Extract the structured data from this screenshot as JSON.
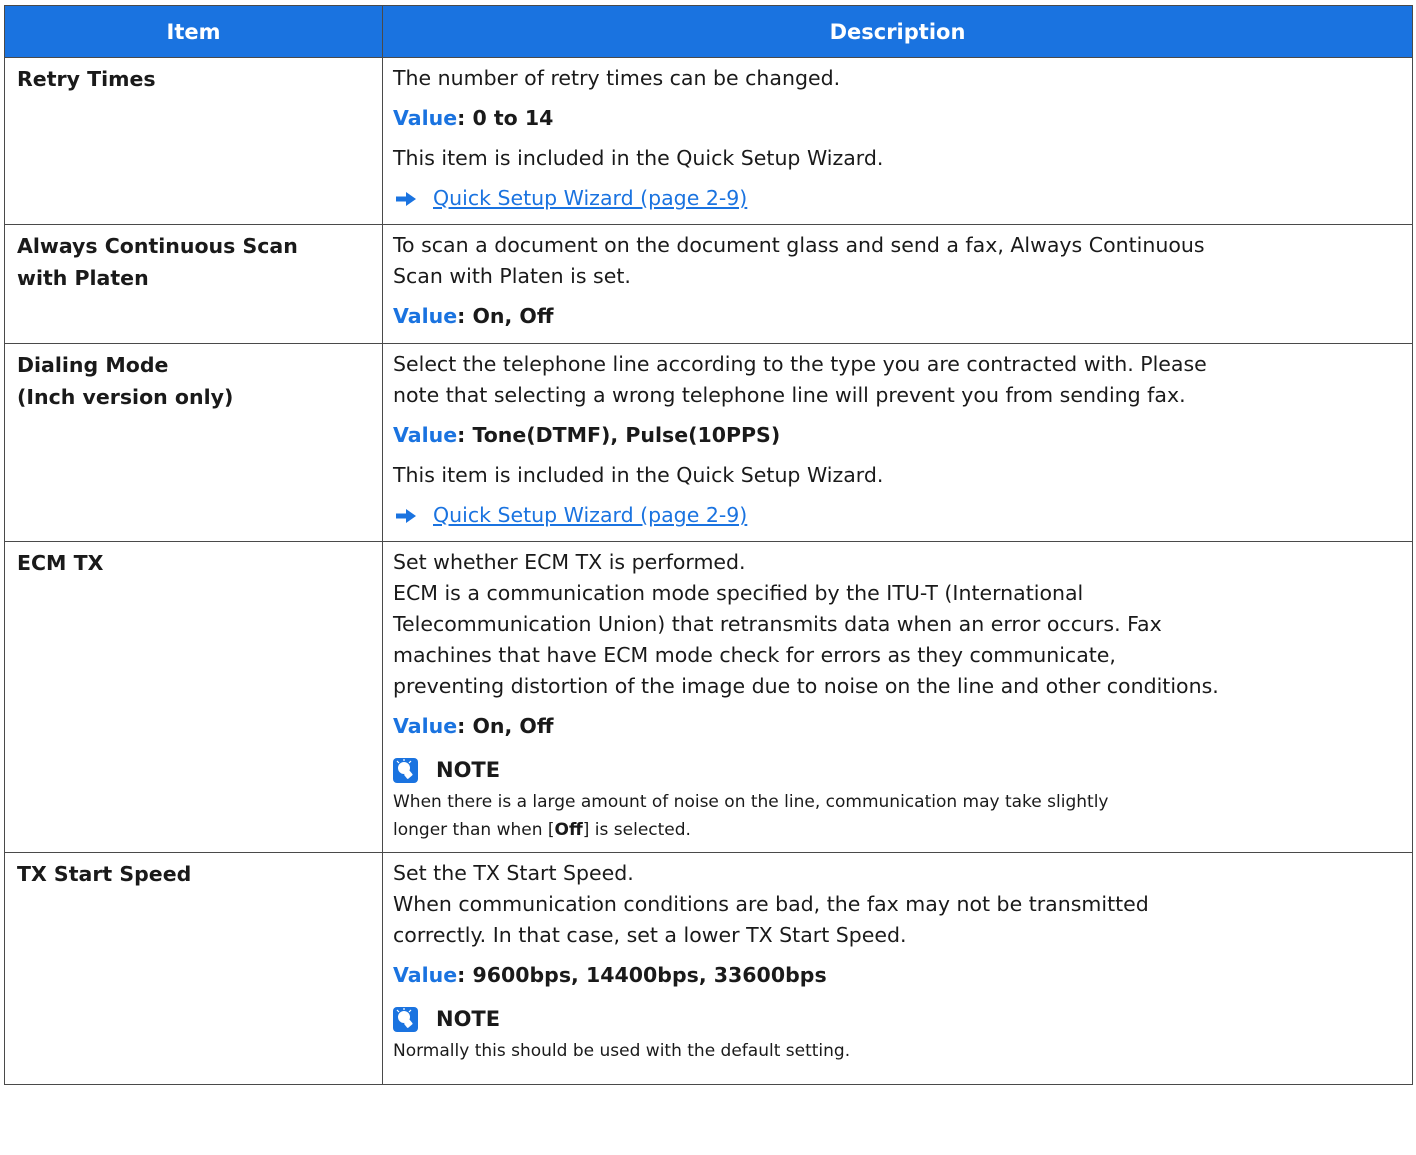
{
  "columns": {
    "item": "Item",
    "description": "Description"
  },
  "accent": "#1a73e0",
  "value_label": "Value",
  "note_label": "NOTE",
  "rows": [
    {
      "item": "Retry Times",
      "desc_1": "The number of retry times can be changed.",
      "value": ": 0 to 14",
      "desc_2": "This item is included in the Quick Setup Wizard.",
      "link": "Quick Setup Wizard (page 2-9)"
    },
    {
      "item_line1": "Always Continuous Scan",
      "item_line2": "with Platen",
      "desc_1a": "To scan a document on the document glass and send a fax, Always Continuous",
      "desc_1b": "Scan with Platen is set.",
      "value": ": On, Off"
    },
    {
      "item_line1": "Dialing Mode",
      "item_line2": "(Inch version only)",
      "desc_1a": "Select the telephone line according to the type you are contracted with. Please",
      "desc_1b": "note that selecting a wrong telephone line will prevent you from sending fax.",
      "value": ": Tone(DTMF), Pulse(10PPS)",
      "desc_2": "This item is included in the Quick Setup Wizard.",
      "link": "Quick Setup Wizard (page 2-9)"
    },
    {
      "item": "ECM TX",
      "lines": [
        "Set whether ECM TX is performed.",
        "ECM is a communication mode specified by the ITU-T (International",
        "Telecommunication Union) that retransmits data when an error occurs. Fax",
        "machines that have ECM mode check for errors as they communicate,",
        "preventing distortion of the image due to noise on the line and other conditions."
      ],
      "value": ": On, Off",
      "note_line1": "When there is a large amount of noise on the line, communication may take slightly",
      "note_line2_pre": "longer than when [",
      "note_line2_bold": "Off",
      "note_line2_post": "] is selected."
    },
    {
      "item": "TX Start Speed",
      "lines": [
        "Set the TX Start Speed.",
        "When communication conditions are bad, the fax may not be transmitted",
        "correctly. In that case, set a lower TX Start Speed."
      ],
      "value": ": 9600bps, 14400bps, 33600bps",
      "note_text": "Normally this should be used with the default setting."
    }
  ]
}
